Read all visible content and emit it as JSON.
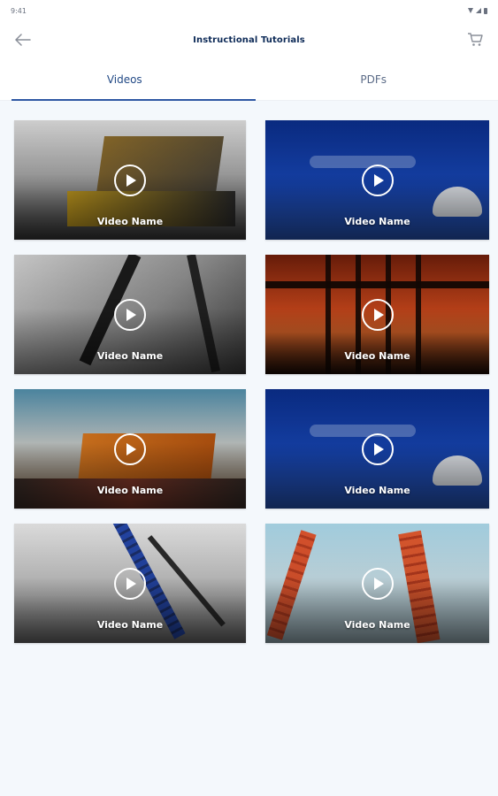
{
  "status_bar": {
    "time": "9:41",
    "icons": [
      "wifi-icon",
      "signal-icon",
      "battery-icon"
    ]
  },
  "header": {
    "title": "Instructional Tutorials",
    "back_icon": "back-arrow-icon",
    "cart_icon": "cart-icon"
  },
  "tabs": [
    {
      "label": "Videos",
      "active": true
    },
    {
      "label": "PDFs",
      "active": false
    }
  ],
  "videos": [
    {
      "name": "Video Name"
    },
    {
      "name": "Video Name"
    },
    {
      "name": "Video Name"
    },
    {
      "name": "Video Name"
    },
    {
      "name": "Video Name"
    },
    {
      "name": "Video Name"
    },
    {
      "name": "Video Name"
    },
    {
      "name": "Video Name"
    }
  ],
  "colors": {
    "title": "#0d2a57",
    "tab_active": "#234a86",
    "tab_indicator": "#2e57a3",
    "content_bg": "#f4f8fc"
  }
}
